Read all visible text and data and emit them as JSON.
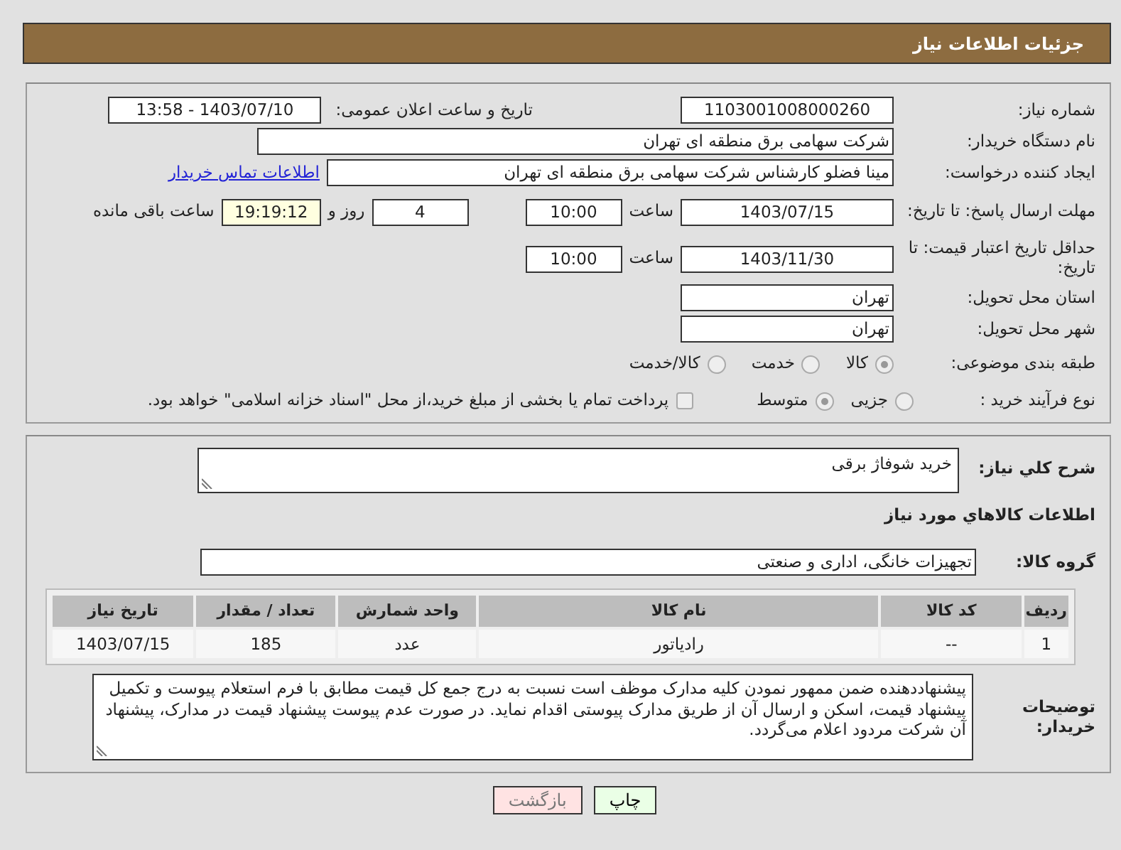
{
  "header": {
    "title": "جزئیات اطلاعات نیاز"
  },
  "need_number": {
    "label": "شماره نیاز:",
    "value": "1103001008000260"
  },
  "announce": {
    "label": "تاریخ و ساعت اعلان عمومی:",
    "value": "1403/07/10 - 13:58"
  },
  "buyer_org": {
    "label": "نام دستگاه خریدار:",
    "value": "شرکت سهامی برق منطقه ای تهران"
  },
  "requester": {
    "label": "ایجاد کننده درخواست:",
    "value": "مینا فضلو کارشناس شرکت سهامی برق منطقه ای تهران",
    "link": "اطلاعات تماس خریدار"
  },
  "deadline": {
    "label": "مهلت ارسال پاسخ: تا تاریخ:",
    "date": "1403/07/15",
    "time_label": "ساعت",
    "time": "10:00",
    "days": "4",
    "days_label": "روز و",
    "remaining": "19:19:12",
    "remaining_label": "ساعت باقی مانده"
  },
  "validity": {
    "label": "حداقل تاریخ اعتبار قیمت: تا تاریخ:",
    "date": "1403/11/30",
    "time_label": "ساعت",
    "time": "10:00"
  },
  "province": {
    "label": "استان محل تحویل:",
    "value": "تهران"
  },
  "city": {
    "label": "شهر محل تحویل:",
    "value": "تهران"
  },
  "category": {
    "label": "طبقه بندی موضوعی:",
    "options": [
      {
        "label": "کالا",
        "selected": true
      },
      {
        "label": "خدمت",
        "selected": false
      },
      {
        "label": "کالا/خدمت",
        "selected": false
      }
    ]
  },
  "purchase_type": {
    "label": "نوع فرآیند خرید :",
    "options": [
      {
        "label": "جزیی",
        "selected": false
      },
      {
        "label": "متوسط",
        "selected": true
      }
    ],
    "checkbox": {
      "label": "پرداخت تمام یا بخشی از مبلغ خرید،از محل \"اسناد خزانه اسلامی\" خواهد بود.",
      "checked": false
    }
  },
  "description": {
    "label": "شرح کلي نياز:",
    "value": "خرید شوفاژ برقی"
  },
  "goods_heading": "اطلاعات کالاهاي مورد نياز",
  "goods_group": {
    "label": "گروه کالا:",
    "value": "تجهیزات خانگی، اداری و صنعتی"
  },
  "table": {
    "columns": [
      "ردیف",
      "کد کالا",
      "نام کالا",
      "واحد شمارش",
      "تعداد / مقدار",
      "تاریخ نیاز"
    ],
    "rows": [
      [
        "1",
        "--",
        "رادیاتور",
        "عدد",
        "185",
        "1403/07/15"
      ]
    ]
  },
  "buyer_notes": {
    "label": "توضیحات خریدار:",
    "value": "پیشنهاددهنده ضمن ممهور نمودن کلیه مدارک موظف است نسبت به درج جمع کل قیمت مطابق با فرم استعلام پیوست و تکمیل پیشنهاد قیمت، اسکن و ارسال آن از طریق مدارک پیوستی اقدام نماید. در صورت عدم پیوست پیشنهاد قیمت در مدارک، پیشنهاد آن شرکت مردود اعلام می‌گردد."
  },
  "buttons": [
    {
      "label": "چاپ",
      "kind": "print"
    },
    {
      "label": "بازگشت",
      "kind": "back"
    }
  ]
}
